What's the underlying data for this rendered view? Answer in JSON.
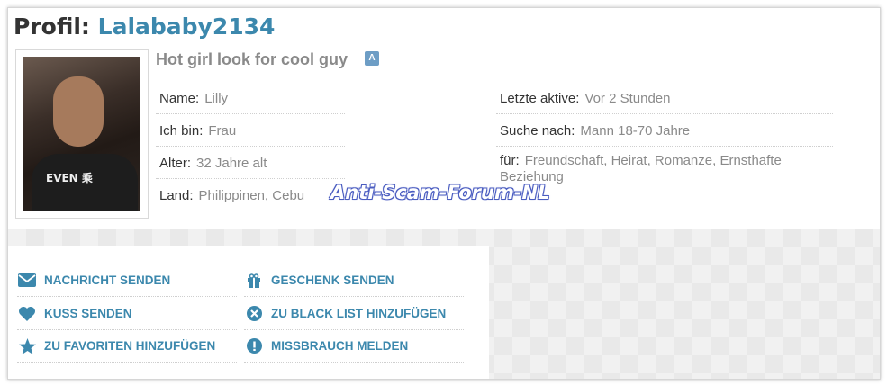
{
  "profile": {
    "title_label": "Profil:",
    "username": "Lalababy2134",
    "headline": "Hot girl look for cool guy"
  },
  "details_left": [
    {
      "key": "Name:",
      "value": "Lilly"
    },
    {
      "key": "Ich bin:",
      "value": "Frau"
    },
    {
      "key": "Alter:",
      "value": "32 Jahre alt"
    },
    {
      "key": "Land:",
      "value": "Philippinen, Cebu"
    }
  ],
  "details_right": [
    {
      "key": "Letzte aktive:",
      "value": "Vor 2 Stunden"
    },
    {
      "key": "Suche nach:",
      "value": "Mann 18-70 Jahre"
    },
    {
      "key": "für:",
      "value": "Freundschaft, Heirat, Romanze, Ernsthafte Beziehung"
    }
  ],
  "photo_text": "EVEN 乘",
  "watermark": "Anti-Scam-Forum-NL",
  "actions": {
    "send_message": "NACHRICHT SENDEN",
    "send_gift": "GESCHENK SENDEN",
    "send_kiss": "KUSS SENDEN",
    "add_blacklist": "ZU BLACK LIST HINZUFÜGEN",
    "add_favorites": "ZU FAVORITEN HINZUFÜGEN",
    "report_abuse": "MISSBRAUCH MELDEN"
  },
  "colors": {
    "accent": "#3c88ad",
    "muted": "#8a8a8a"
  }
}
